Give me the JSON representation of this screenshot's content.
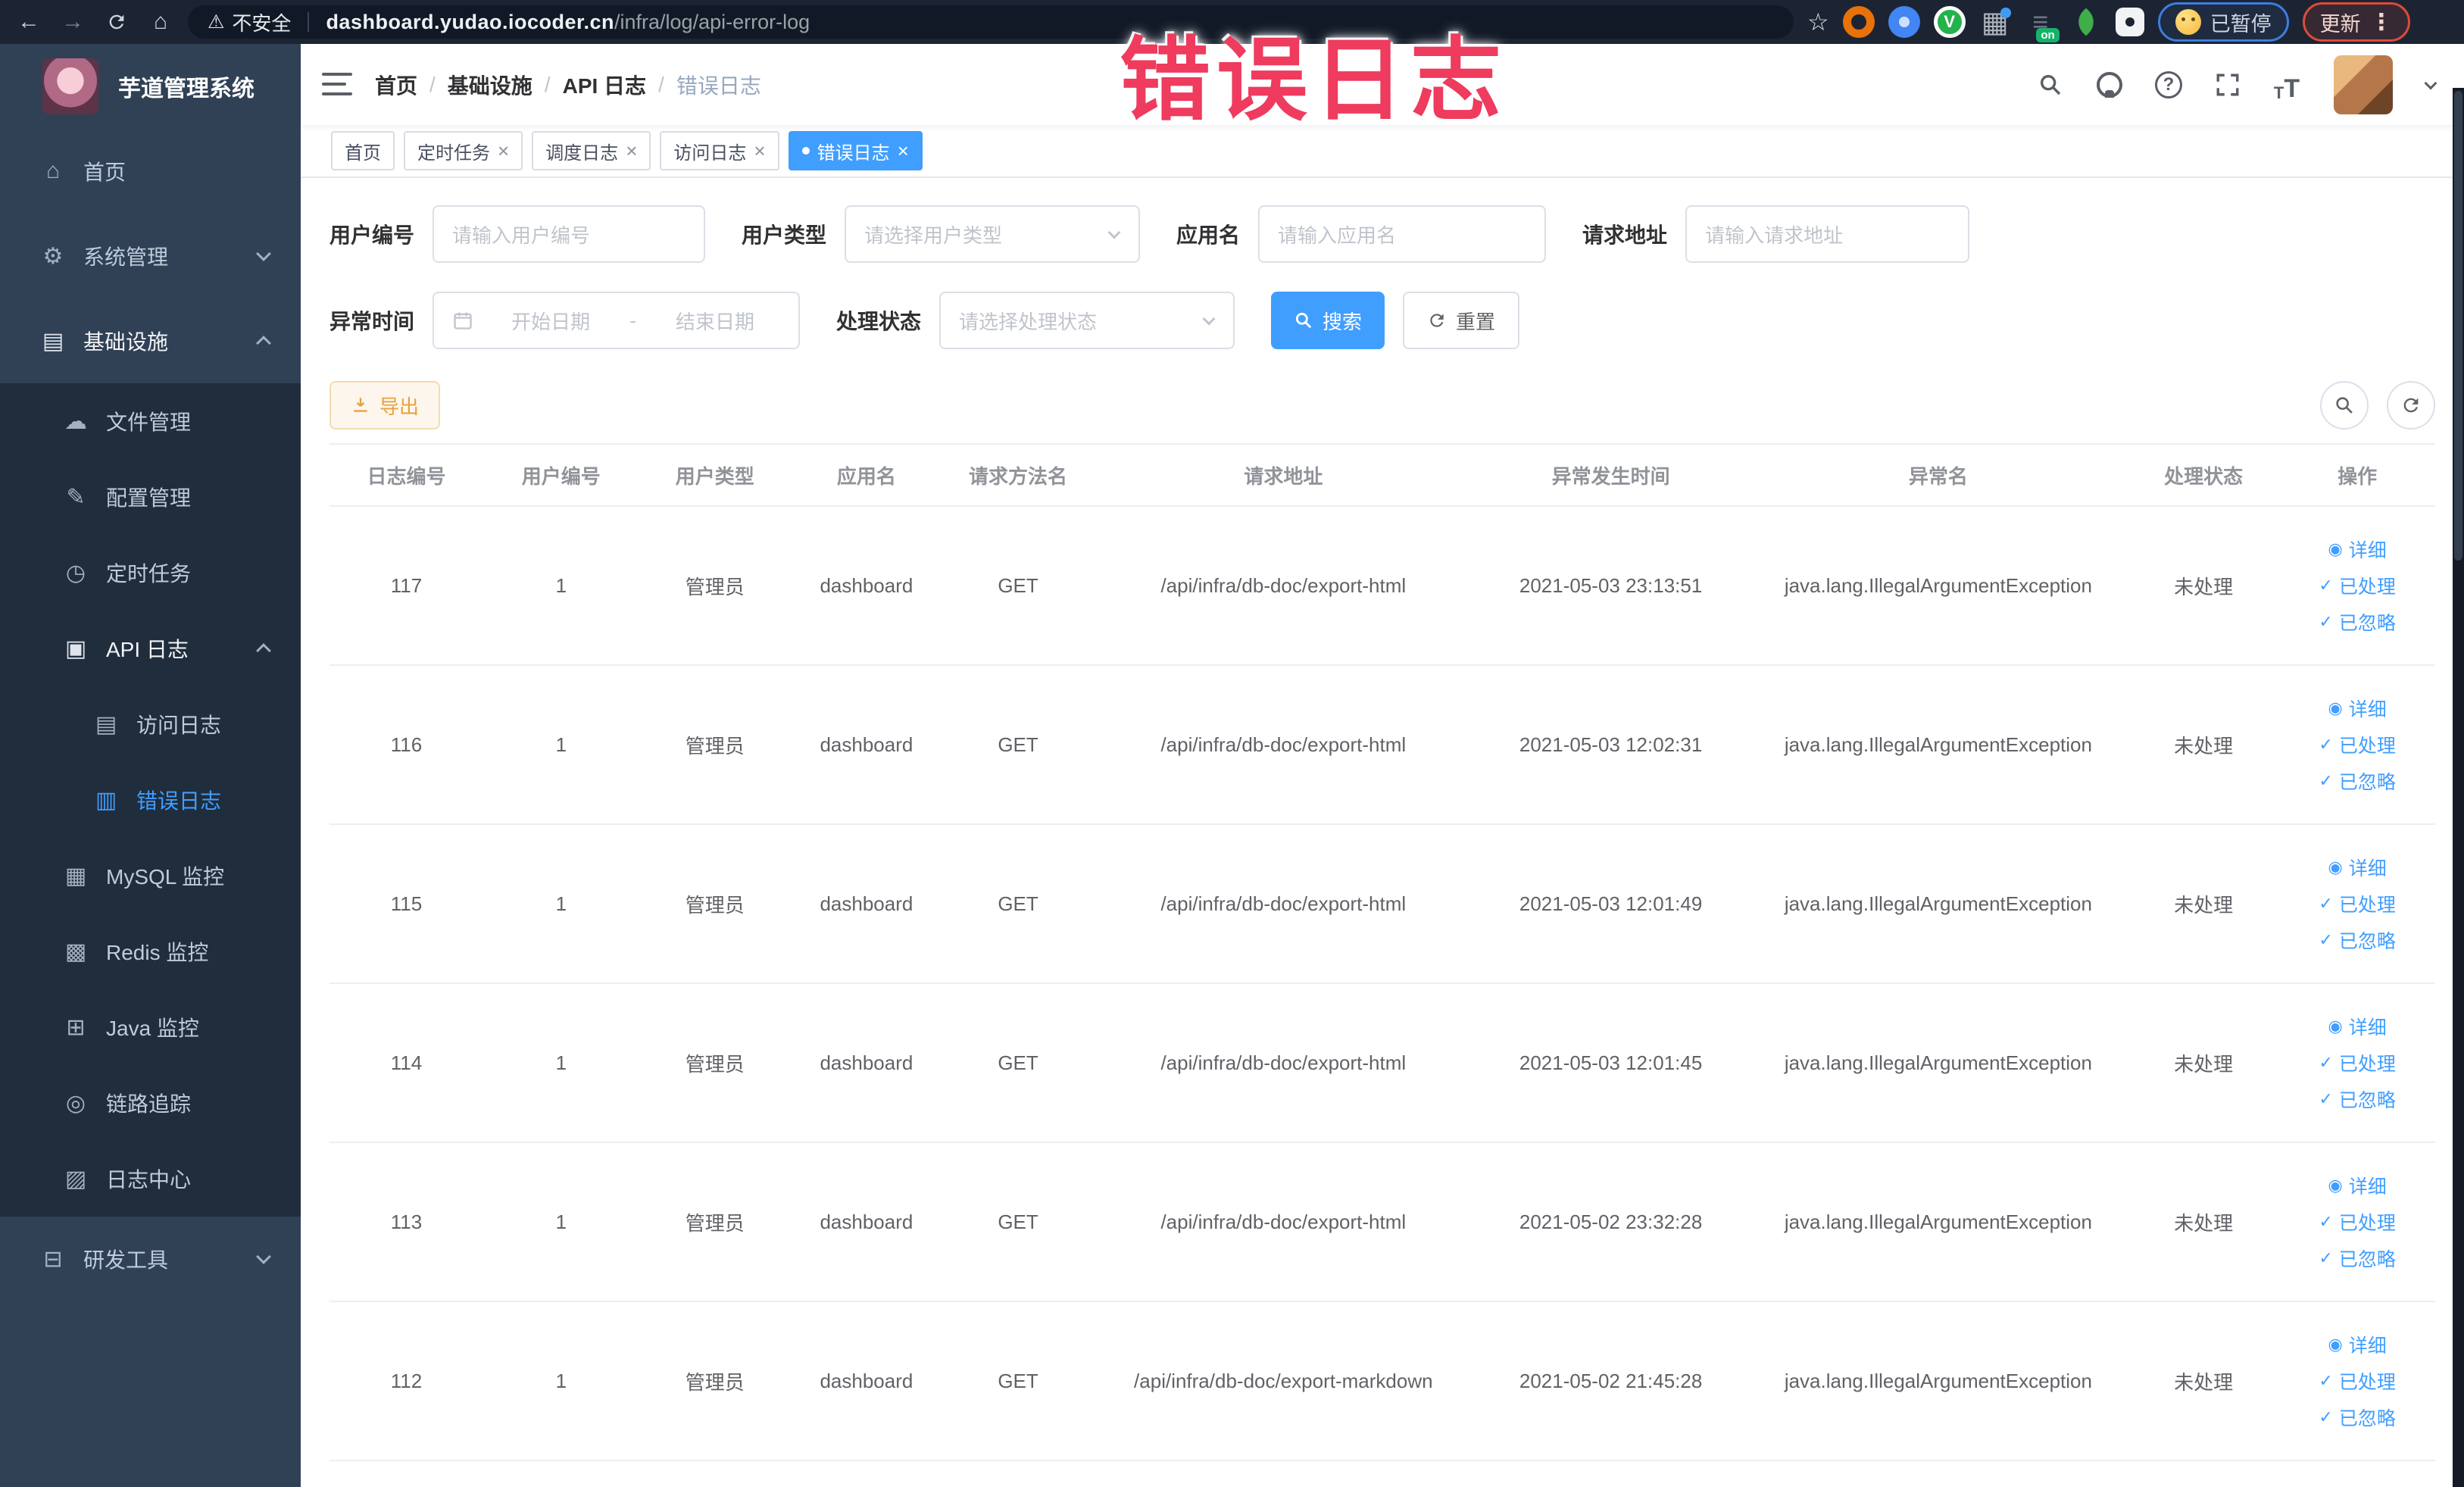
{
  "watermark": {
    "text": "错误日志"
  },
  "browser": {
    "security": "不安全",
    "url_host": "dashboard.yudao.iocoder.cn",
    "url_path": "/infra/log/api-error-log",
    "extensions": [
      "orange-ring",
      "blue-pin",
      "green-v",
      "grid",
      "dark-on",
      "green-leaf",
      "puzzle"
    ],
    "paused_label": "已暂停",
    "update_label": "更新"
  },
  "sidebar": {
    "title": "芋道管理系统",
    "menu": [
      {
        "key": "home",
        "label": "首页",
        "icon": "home-icon",
        "level": 1,
        "section": "top"
      },
      {
        "key": "system",
        "label": "系统管理",
        "icon": "gear-icon",
        "level": 1,
        "section": "top",
        "arrow": "down"
      },
      {
        "key": "infra",
        "label": "基础设施",
        "icon": "infra-icon",
        "level": 1,
        "section": "top",
        "arrow": "up",
        "open": true
      },
      {
        "key": "file",
        "label": "文件管理",
        "icon": "file-icon",
        "level": 2,
        "section": "sub"
      },
      {
        "key": "config",
        "label": "配置管理",
        "icon": "config-icon",
        "level": 2,
        "section": "sub"
      },
      {
        "key": "job",
        "label": "定时任务",
        "icon": "cron-icon",
        "level": 2,
        "section": "sub"
      },
      {
        "key": "api-log",
        "label": "API 日志",
        "icon": "api-log-icon",
        "level": 2,
        "section": "sub",
        "arrow": "up",
        "open": true
      },
      {
        "key": "access-log",
        "label": "访问日志",
        "icon": "access-log-icon",
        "level": 3,
        "section": "sub"
      },
      {
        "key": "error-log",
        "label": "错误日志",
        "icon": "error-log-icon",
        "level": 3,
        "section": "sub",
        "active": true
      },
      {
        "key": "mysql",
        "label": "MySQL 监控",
        "icon": "mysql-icon",
        "level": 2,
        "section": "sub"
      },
      {
        "key": "redis",
        "label": "Redis 监控",
        "icon": "redis-icon",
        "level": 2,
        "section": "sub"
      },
      {
        "key": "java",
        "label": "Java 监控",
        "icon": "java-icon",
        "level": 2,
        "section": "sub"
      },
      {
        "key": "trace",
        "label": "链路追踪",
        "icon": "trace-icon",
        "level": 2,
        "section": "sub"
      },
      {
        "key": "log-center",
        "label": "日志中心",
        "icon": "log-center-icon",
        "level": 2,
        "section": "sub"
      },
      {
        "key": "devtools",
        "label": "研发工具",
        "icon": "devtools-icon",
        "level": 1,
        "section": "bottom",
        "arrow": "down"
      }
    ]
  },
  "header": {
    "breadcrumb": [
      "首页",
      "基础设施",
      "API 日志",
      "错误日志"
    ]
  },
  "tags": [
    {
      "label": "首页",
      "closable": false,
      "active": false
    },
    {
      "label": "定时任务",
      "closable": true,
      "active": false
    },
    {
      "label": "调度日志",
      "closable": true,
      "active": false
    },
    {
      "label": "访问日志",
      "closable": true,
      "active": false
    },
    {
      "label": "错误日志",
      "closable": true,
      "active": true
    }
  ],
  "filters": {
    "user_id": {
      "label": "用户编号",
      "placeholder": "请输入用户编号"
    },
    "user_type": {
      "label": "用户类型",
      "placeholder": "请选择用户类型"
    },
    "app_name": {
      "label": "应用名",
      "placeholder": "请输入应用名"
    },
    "request_url": {
      "label": "请求地址",
      "placeholder": "请输入请求地址"
    },
    "exception_time": {
      "label": "异常时间",
      "start_placeholder": "开始日期",
      "separator": "-",
      "end_placeholder": "结束日期"
    },
    "process_status": {
      "label": "处理状态",
      "placeholder": "请选择处理状态"
    },
    "search_label": "搜索",
    "reset_label": "重置"
  },
  "toolbar": {
    "export_label": "导出"
  },
  "table": {
    "columns": [
      "日志编号",
      "用户编号",
      "用户类型",
      "应用名",
      "请求方法名",
      "请求地址",
      "异常发生时间",
      "异常名",
      "处理状态",
      "操作"
    ],
    "actions": [
      "详细",
      "已处理",
      "已忽略"
    ],
    "rows": [
      {
        "id": "117",
        "user_id": "1",
        "user_type": "管理员",
        "app": "dashboard",
        "method": "GET",
        "url": "/api/infra/db-doc/export-html",
        "time": "2021-05-03 23:13:51",
        "exception": "java.lang.IllegalArgumentException",
        "status": "未处理"
      },
      {
        "id": "116",
        "user_id": "1",
        "user_type": "管理员",
        "app": "dashboard",
        "method": "GET",
        "url": "/api/infra/db-doc/export-html",
        "time": "2021-05-03 12:02:31",
        "exception": "java.lang.IllegalArgumentException",
        "status": "未处理"
      },
      {
        "id": "115",
        "user_id": "1",
        "user_type": "管理员",
        "app": "dashboard",
        "method": "GET",
        "url": "/api/infra/db-doc/export-html",
        "time": "2021-05-03 12:01:49",
        "exception": "java.lang.IllegalArgumentException",
        "status": "未处理"
      },
      {
        "id": "114",
        "user_id": "1",
        "user_type": "管理员",
        "app": "dashboard",
        "method": "GET",
        "url": "/api/infra/db-doc/export-html",
        "time": "2021-05-03 12:01:45",
        "exception": "java.lang.IllegalArgumentException",
        "status": "未处理"
      },
      {
        "id": "113",
        "user_id": "1",
        "user_type": "管理员",
        "app": "dashboard",
        "method": "GET",
        "url": "/api/infra/db-doc/export-html",
        "time": "2021-05-02 23:32:28",
        "exception": "java.lang.IllegalArgumentException",
        "status": "未处理"
      },
      {
        "id": "112",
        "user_id": "1",
        "user_type": "管理员",
        "app": "dashboard",
        "method": "GET",
        "url": "/api/infra/db-doc/export-markdown",
        "time": "2021-05-02 21:45:28",
        "exception": "java.lang.IllegalArgumentException",
        "status": "未处理"
      }
    ]
  },
  "colors": {
    "accent": "#409eff",
    "warning": "#e6a23c",
    "watermark": "#ee3b5e",
    "sidebar_bg": "#304156",
    "submenu_bg": "#1f2d3d"
  }
}
